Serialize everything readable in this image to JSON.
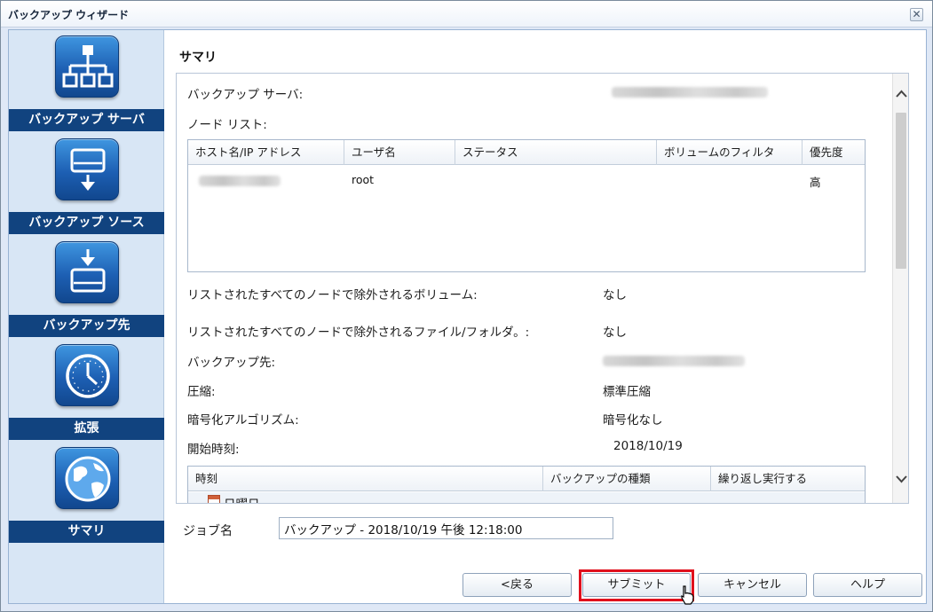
{
  "window": {
    "title": "バックアップ ウィザード",
    "close_symbol": "✕"
  },
  "sidebar": {
    "steps": [
      {
        "label": "バックアップ サーバ",
        "icon": "network-tree-icon"
      },
      {
        "label": "バックアップ ソース",
        "icon": "drive-download-icon"
      },
      {
        "label": "バックアップ先",
        "icon": "drive-upload-icon"
      },
      {
        "label": "拡張",
        "icon": "clock-icon"
      },
      {
        "label": "サマリ",
        "icon": "globe-icon",
        "active": true
      }
    ]
  },
  "main": {
    "title": "サマリ",
    "backup_server_label": "バックアップ サーバ:",
    "node_list_label": "ノード リスト:",
    "node_table": {
      "columns": [
        "ホスト名/IP アドレス",
        "ユーザ名",
        "ステータス",
        "ボリュームのフィルタ",
        "優先度"
      ],
      "rows": [
        {
          "host": "",
          "user": "root",
          "status": "",
          "filter": "",
          "priority": "高"
        }
      ]
    },
    "excluded_volumes_label": "リストされたすべてのノードで除外されるボリューム:",
    "excluded_volumes_value": "なし",
    "excluded_files_label": "リストされたすべてのノードで除外されるファイル/フォルダ。:",
    "excluded_files_value": "なし",
    "destination_label": "バックアップ先:",
    "compression_label": "圧縮:",
    "compression_value": "標準圧縮",
    "encryption_label": "暗号化アルゴリズム:",
    "encryption_value": "暗号化なし",
    "start_time_label": "開始時刻:",
    "start_time_value": "2018/10/19",
    "schedule_table": {
      "columns": [
        "時刻",
        "バックアップの種類",
        "繰り返し実行する"
      ],
      "first_row": "日曜日"
    },
    "job_name_label": "ジョブ名",
    "job_name_value": "バックアップ - 2018/10/19 午後 12:18:00"
  },
  "buttons": {
    "back": "<戻る",
    "submit": "サブミット",
    "cancel": "キャンセル",
    "help": "ヘルプ"
  },
  "colors": {
    "sidebar_label_bg": "#11437f",
    "highlight": "#e0101c"
  }
}
